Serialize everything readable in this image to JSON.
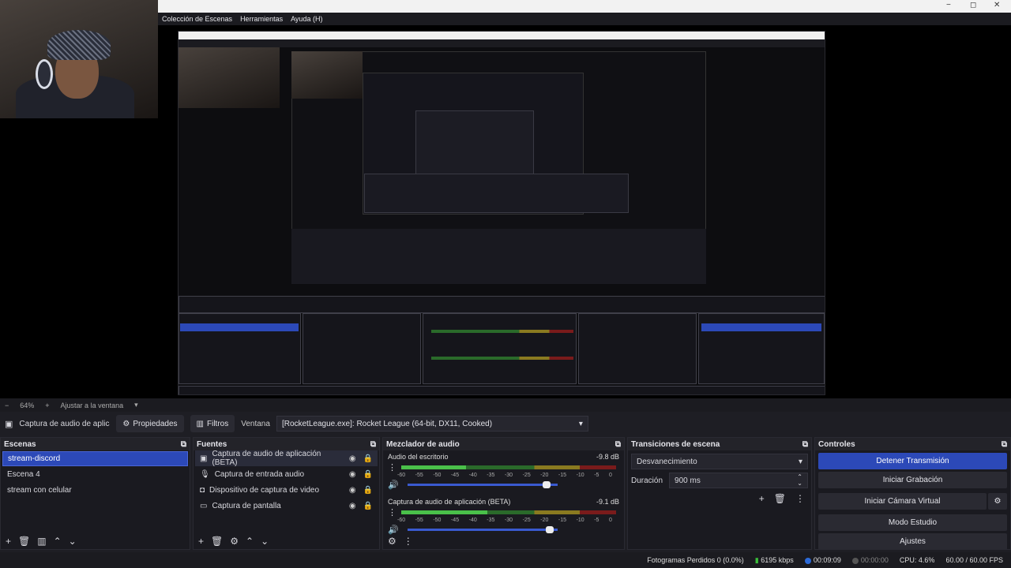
{
  "menubar": {
    "items": [
      "Colección de Escenas",
      "Herramientas",
      "Ayuda (H)"
    ]
  },
  "window_controls": [
    "−",
    "◻",
    "✕"
  ],
  "zoombar": {
    "minus": "−",
    "zoom": "64%",
    "plus": "+",
    "fit": "Ajustar a la ventana"
  },
  "source_toolbar": {
    "source_name": "Captura de audio de aplicac",
    "properties": "Propiedades",
    "filters": "Filtros",
    "window_label": "Ventana",
    "window_value": "[RocketLeague.exe]: Rocket League (64-bit, DX11, Cooked)"
  },
  "scenes": {
    "title": "Escenas",
    "items": [
      "stream-discord",
      "Escena 4",
      "stream con celular"
    ]
  },
  "sources": {
    "title": "Fuentes",
    "items": [
      "Captura de audio de aplicación (BETA)",
      "Captura de entrada audio",
      "Dispositivo de captura de video",
      "Captura de pantalla"
    ]
  },
  "mixer": {
    "title": "Mezclador de audio",
    "channels": [
      {
        "name": "Audio del escritorio",
        "db": "-9.8 dB",
        "level": 0.3,
        "volume": 0.93
      },
      {
        "name": "Captura de audio de aplicación (BETA)",
        "db": "-9.1 dB",
        "level": 0.4,
        "volume": 0.95
      }
    ],
    "scale": [
      "-60",
      "-55",
      "-50",
      "-45",
      "-40",
      "-35",
      "-30",
      "-25",
      "-20",
      "-15",
      "-10",
      "-5",
      "0"
    ]
  },
  "transitions": {
    "title": "Transiciones de escena",
    "selected": "Desvanecimiento",
    "duration_label": "Duración",
    "duration_value": "900 ms"
  },
  "controls": {
    "title": "Controles",
    "stop_stream": "Detener Transmisión",
    "start_recording": "Iniciar Grabación",
    "start_virtual_cam": "Iniciar Cámara Virtual",
    "studio_mode": "Modo Estudio",
    "settings": "Ajustes"
  },
  "status": {
    "dropped": "Fotogramas Perdidos 0 (0.0%)",
    "bitrate": "6195 kbps",
    "stream_time": "00:09:09",
    "rec_time": "00:00:00",
    "cpu": "CPU: 4.6%",
    "fps": "60.00 / 60.00 FPS"
  },
  "colors": {
    "accent": "#2c49b8",
    "panel": "#1a1a20"
  }
}
